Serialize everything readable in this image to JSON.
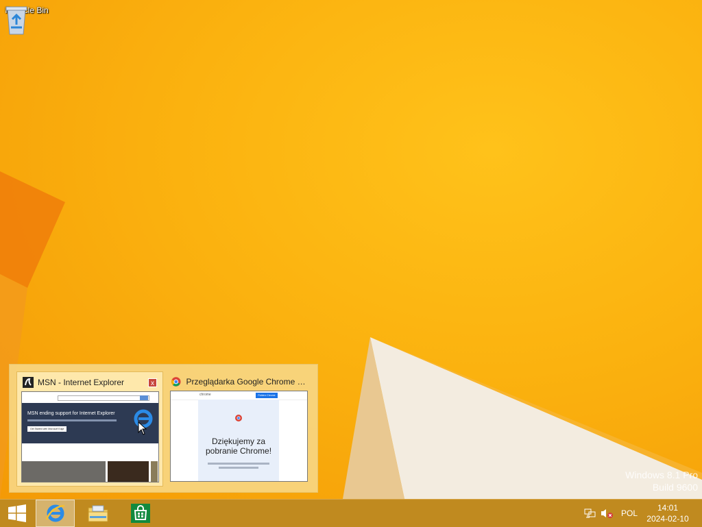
{
  "desktop": {
    "recycle_bin_label": "Recycle Bin",
    "watermark_line1": "Windows 8.1 Pro",
    "watermark_line2": "Build 9600"
  },
  "thumbnails": [
    {
      "title": "MSN - Internet Explorer",
      "preview": {
        "headline": "MSN ending support for Internet Explorer",
        "button": "Get Started with Microsoft Edge"
      },
      "close_label": "x"
    },
    {
      "title": "Przeglądarka Google Chrome - I...",
      "preview": {
        "logo_text": "chrome",
        "nav_button": "Pobierz Chrome",
        "heading": "Dziękujemy za pobranie Chrome!"
      }
    }
  ],
  "taskbar": {
    "pinned": [
      "start-button",
      "internet-explorer",
      "file-explorer",
      "store"
    ],
    "language": "POL",
    "time": "14:01",
    "date": "2024-02-10"
  },
  "colors": {
    "wallpaper": "#f7a90c",
    "taskbar": "#c08a1f",
    "popup": "#f7d682"
  }
}
